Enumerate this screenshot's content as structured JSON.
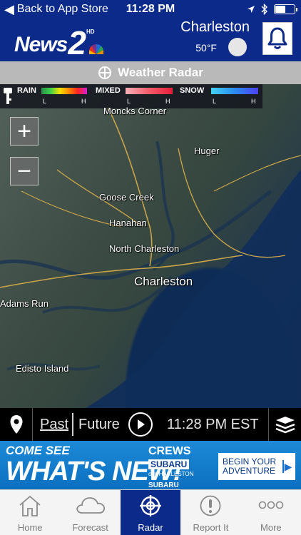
{
  "status_bar": {
    "back_label": "Back to App Store",
    "time": "11:28 PM",
    "battery_level": 0.55
  },
  "header": {
    "logo_text": "News",
    "logo_number": "2",
    "logo_hd": "HD",
    "city": "Charleston",
    "temperature": "50°F",
    "notifications_icon": "bell-icon"
  },
  "radar_title": {
    "icon": "crosshair-icon",
    "title": "Weather Radar"
  },
  "legend": {
    "rain_label": "RAIN",
    "mixed_label": "MIXED",
    "snow_label": "SNOW",
    "low_label": "L",
    "high_label": "H",
    "rain_colors": [
      "#2a8f4a",
      "#3bd24b",
      "#f3e100",
      "#ff8a00",
      "#ff2222",
      "#d21fd6"
    ],
    "mixed_colors": [
      "#f7b1b8",
      "#f45b6b",
      "#e41e3a"
    ],
    "snow_colors": [
      "#43d3f5",
      "#2b8cf0",
      "#4b41f2"
    ]
  },
  "map": {
    "places": [
      {
        "name": "Moncks Corner"
      },
      {
        "name": "Huger"
      },
      {
        "name": "Goose Creek"
      },
      {
        "name": "Hanahan"
      },
      {
        "name": "North Charleston"
      },
      {
        "name": "Charleston"
      },
      {
        "name": "Adams Run"
      },
      {
        "name": "Edisto Island"
      }
    ],
    "zoom_in": "+",
    "zoom_out": "−"
  },
  "timeline": {
    "past_label": "Past",
    "future_label": "Future",
    "timestamp": "11:28 PM EST"
  },
  "ad": {
    "line1": "COME SEE",
    "line2": "WHAT'S NEW!",
    "dealer_name": "CREWS",
    "dealer_brand": "SUBARU",
    "dealer_location": "of CHARLESTON",
    "brand_footer": "SUBARU",
    "cta": "BEGIN YOUR ADVENTURE"
  },
  "tabs": [
    {
      "label": "Home",
      "icon": "home-icon",
      "active": false
    },
    {
      "label": "Forecast",
      "icon": "cloud-icon",
      "active": false
    },
    {
      "label": "Radar",
      "icon": "radar-icon",
      "active": true
    },
    {
      "label": "Report It",
      "icon": "alert-icon",
      "active": false
    },
    {
      "label": "More",
      "icon": "more-icon",
      "active": false
    }
  ],
  "colors": {
    "brand_blue": "#0b2a8a",
    "title_bar": "#b9b9b9",
    "ad_blue": "#0b6fc0"
  }
}
